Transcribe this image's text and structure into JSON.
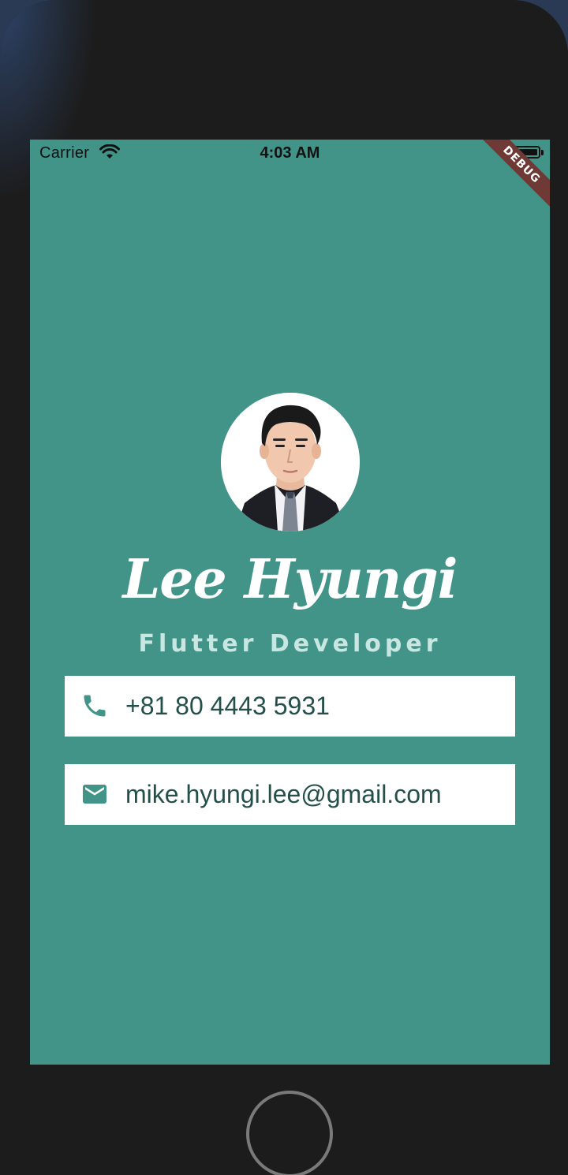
{
  "status_bar": {
    "carrier": "Carrier",
    "time": "4:03 AM",
    "wifi_icon": "wifi-icon",
    "battery_icon": "battery-icon"
  },
  "debug_banner": "DEBUG",
  "profile": {
    "avatar": "profile-photo",
    "name": "Lee Hyungi",
    "title": "Flutter Developer"
  },
  "contacts": {
    "phone": {
      "icon": "phone-icon",
      "value": "+81 80 4443 5931"
    },
    "email": {
      "icon": "mail-icon",
      "value": "mike.hyungi.lee@gmail.com"
    }
  },
  "colors": {
    "background": "#429488",
    "card": "#ffffff",
    "text_dark": "#23504a",
    "title_text": "#c8e6e2",
    "icon": "#429488"
  }
}
